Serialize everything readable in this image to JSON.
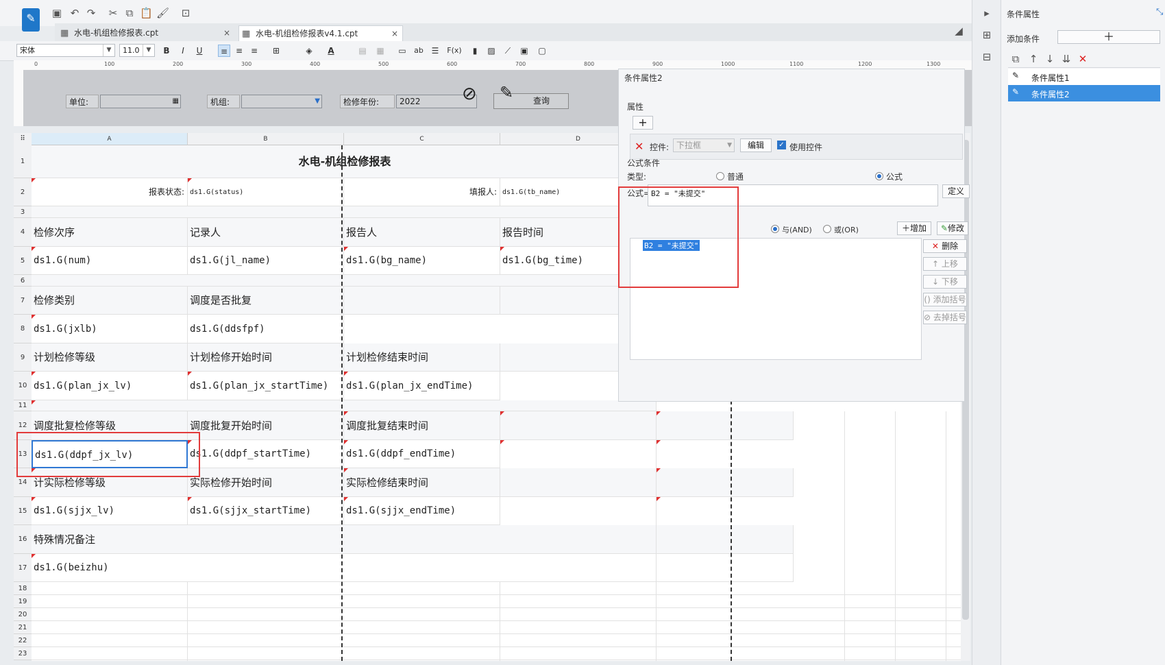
{
  "tabs": [
    {
      "label": "水电-机组检修报表.cpt",
      "active": false
    },
    {
      "label": "水电-机组检修报表v4.1.cpt",
      "active": true
    }
  ],
  "toolbar": {
    "font_name": "宋体",
    "font_size": "11.0",
    "bold": "B",
    "italic": "I",
    "underline": "U",
    "fx": "F(x)",
    "ab": "ab"
  },
  "ruler": {
    "ticks": [
      "100",
      "200",
      "300",
      "400",
      "500",
      "600",
      "700",
      "800",
      "900",
      "1000",
      "1100",
      "1200",
      "1300"
    ],
    "zero": "0"
  },
  "params": {
    "unit_label": "单位:",
    "unit_value": "",
    "group_label": "机组:",
    "group_value": "",
    "year_label": "检修年份:",
    "year_value": "2022",
    "query_label": "查询"
  },
  "columns": [
    "A",
    "B",
    "C",
    "D"
  ],
  "rows": [
    "1",
    "2",
    "3",
    "4",
    "5",
    "6",
    "7",
    "8",
    "9",
    "10",
    "11",
    "12",
    "13",
    "14",
    "15",
    "16",
    "17",
    "18",
    "19",
    "20",
    "21",
    "22",
    "23"
  ],
  "report": {
    "title": "水电-机组检修报表",
    "status_label": "报表状态:",
    "status_field": "ds1.G(status)",
    "reporter_label": "填报人:",
    "reporter_field": "ds1.G(tb_name)",
    "r4": [
      "检修次序",
      "记录人",
      "报告人",
      "报告时间"
    ],
    "r5": [
      "ds1.G(num)",
      "ds1.G(jl_name)",
      "ds1.G(bg_name)",
      "ds1.G(bg_time)"
    ],
    "r7": [
      "检修类别",
      "调度是否批复"
    ],
    "r8": [
      "ds1.G(jxlb)",
      "ds1.G(ddsfpf)"
    ],
    "r9": [
      "计划检修等级",
      "计划检修开始时间",
      "计划检修结束时间"
    ],
    "r10": [
      "ds1.G(plan_jx_lv)",
      "ds1.G(plan_jx_startTime)",
      "ds1.G(plan_jx_endTime)"
    ],
    "r12": [
      "调度批复检修等级",
      "调度批复开始时间",
      "调度批复结束时间"
    ],
    "r13": [
      "ds1.G(ddpf_jx_lv)",
      "ds1.G(ddpf_startTime)",
      "ds1.G(ddpf_endTime)"
    ],
    "r14": [
      "计实际检修等级",
      "实际检修开始时间",
      "实际检修结束时间"
    ],
    "r15": [
      "ds1.G(sjjx_lv)",
      "ds1.G(sjjx_startTime)",
      "ds1.G(sjjx_endTime)"
    ],
    "r16": "特殊情况备注",
    "r17": "ds1.G(beizhu)"
  },
  "dialog": {
    "title": "条件属性2",
    "attr_section": "属性",
    "add_symbol": "+",
    "control_label": "控件:",
    "control_value": "下拉框",
    "edit_button": "编辑",
    "use_control": "使用控件",
    "formula_section": "公式条件",
    "type_label": "类型:",
    "type_normal": "普通",
    "type_formula": "公式",
    "formula_label": "公式=",
    "formula_value": "B2 = \"未提交\"",
    "define_button": "定义",
    "and_label": "与(AND)",
    "or_label": "或(OR)",
    "add_button": "增加",
    "modify_button": "修改",
    "delete_button": "删除",
    "up_button": "上移",
    "down_button": "下移",
    "add_bracket": "添加括号",
    "remove_bracket": "去掉括号",
    "list_item": "B2 = \"未提交\""
  },
  "right_panel": {
    "title": "条件属性",
    "add_condition": "添加条件",
    "items": [
      "条件属性1",
      "条件属性2"
    ]
  },
  "colors": {
    "accent": "#3b8fe0",
    "highlight_box": "#e23b3b",
    "selection": "#2f78d4"
  }
}
